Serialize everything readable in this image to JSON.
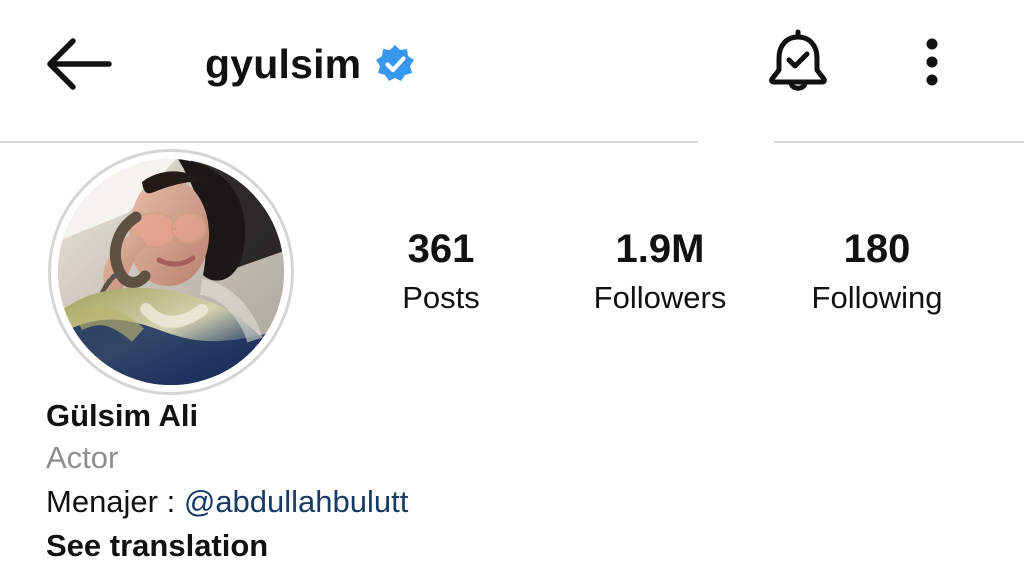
{
  "header": {
    "username": "gyulsim",
    "verified_icon": "verified-badge-icon",
    "back_icon": "back-arrow-icon",
    "notification_icon": "bell-check-icon",
    "more_icon": "more-vertical-icon"
  },
  "profile": {
    "avatar_icon": "profile-photo",
    "display_name": "Gülsim Ali",
    "category": "Actor",
    "bio_prefix": "Menajer : ",
    "bio_mention": "@abdullahbulutt",
    "translation_link": "See translation"
  },
  "stats": {
    "posts": {
      "count": "361",
      "label": "Posts"
    },
    "followers": {
      "count": "1.9M",
      "label": "Followers"
    },
    "following": {
      "count": "180",
      "label": "Following"
    }
  },
  "colors": {
    "verified": "#3897f0",
    "mention": "#173b64",
    "secondary_text": "#8e8e8e",
    "divider": "#d9d9d9"
  }
}
